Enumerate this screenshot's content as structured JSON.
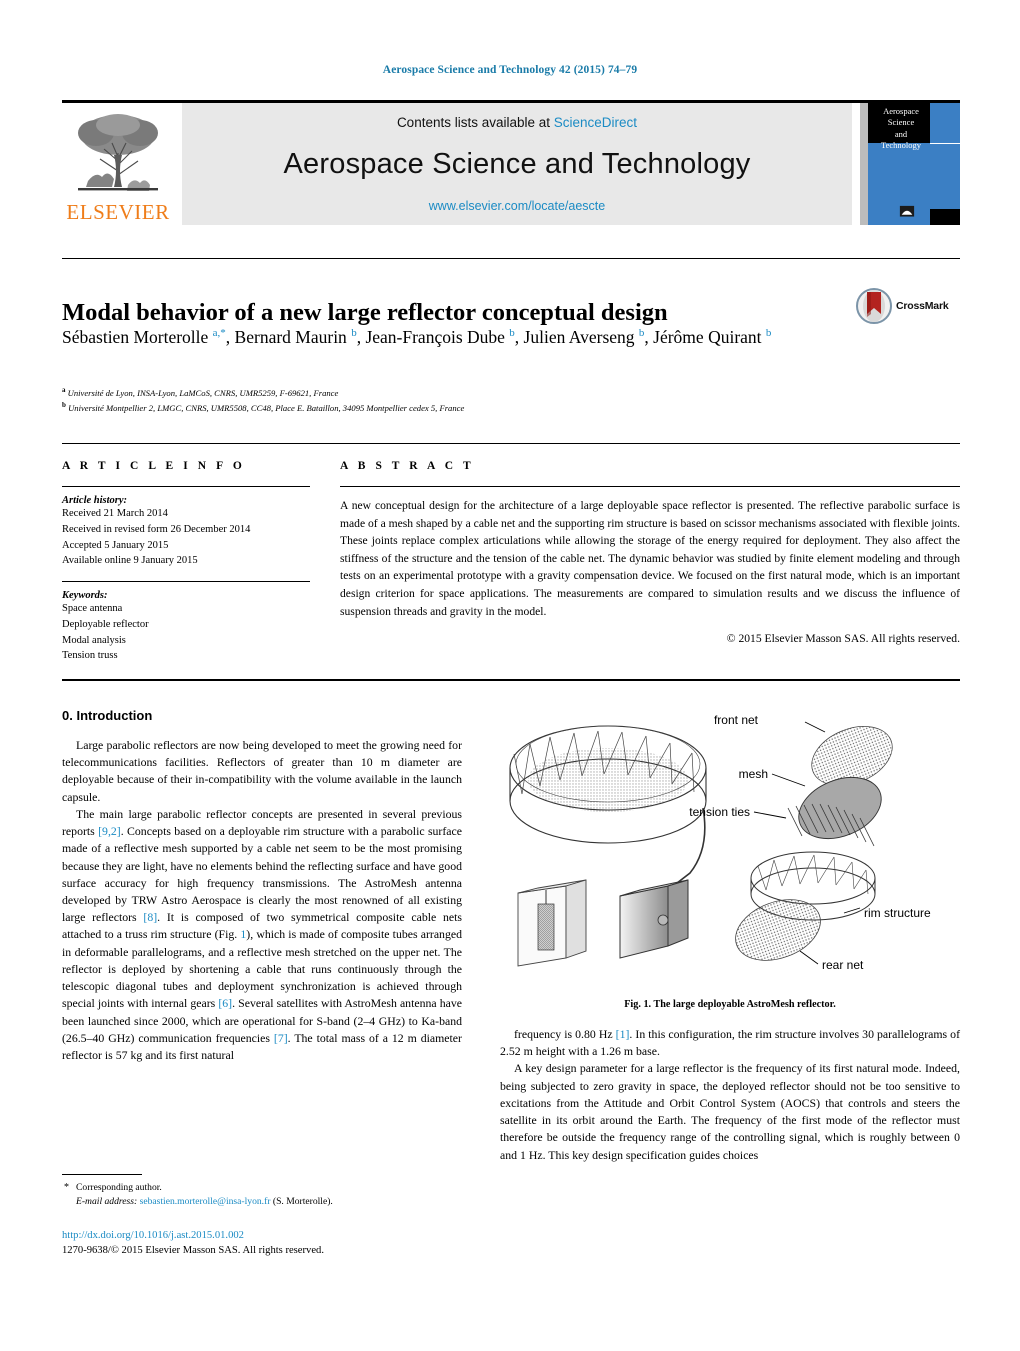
{
  "running_head": "Aerospace Science and Technology 42 (2015) 74–79",
  "masthead": {
    "publisher_name": "ELSEVIER",
    "contents_prefix": "Contents lists available at ",
    "contents_link": "ScienceDirect",
    "journal_name": "Aerospace Science and Technology",
    "journal_url": "www.elsevier.com/locate/aescte",
    "cover_title_line1": "Aerospace",
    "cover_title_line2": "Science",
    "cover_title_line3": "and",
    "cover_title_line4": "Technology",
    "link_color": "#1b8bc4",
    "banner_bg": "#e8e8e8",
    "brand_orange": "#ef7d1a",
    "cover_blue": "#3b7fc4"
  },
  "crossmark": {
    "label": "CrossMark"
  },
  "article": {
    "title": "Modal behavior of a new large reflector conceptual design",
    "authors_html": "Sébastien Morterolle <sup>a,*</sup>, Bernard Maurin <sup>b</sup>, Jean-François Dube <sup>b</sup>, Julien Averseng <sup>b</sup>, Jérôme Quirant <sup>b</sup>",
    "affiliation_a": "Université de Lyon, INSA-Lyon, LaMCoS, CNRS, UMR5259, F-69621, France",
    "affiliation_b": "Université Montpellier 2, LMGC, CNRS, UMR5508, CC48, Place E. Bataillon, 34095 Montpellier cedex 5, France",
    "affiliation_a_marker": "a",
    "affiliation_b_marker": "b"
  },
  "article_info": {
    "heading": "A R T I C L E  I N F O",
    "history_label": "Article history:",
    "history": [
      "Received 21 March 2014",
      "Received in revised form 26 December 2014",
      "Accepted 5 January 2015",
      "Available online 9 January 2015"
    ],
    "keywords_label": "Keywords:",
    "keywords": [
      "Space antenna",
      "Deployable reflector",
      "Modal analysis",
      "Tension truss"
    ]
  },
  "abstract": {
    "heading": "A B S T R A C T",
    "body": "A new conceptual design for the architecture of a large deployable space reflector is presented. The reflective parabolic surface is made of a mesh shaped by a cable net and the supporting rim structure is based on scissor mechanisms associated with flexible joints. These joints replace complex articulations while allowing the storage of the energy required for deployment. They also affect the stiffness of the structure and the tension of the cable net. The dynamic behavior was studied by finite element modeling and through tests on an experimental prototype with a gravity compensation device. We focused on the first natural mode, which is an important design criterion for space applications. The measurements are compared to simulation results and we discuss the influence of suspension threads and gravity in the model.",
    "copyright": "© 2015 Elsevier Masson SAS. All rights reserved."
  },
  "body": {
    "section_heading": "0. Introduction",
    "left_paragraphs": [
      "Large parabolic reflectors are now being developed to meet the growing need for telecommunications facilities. Reflectors of greater than 10 m diameter are deployable because of their in-compatibility with the volume available in the launch capsule.",
      "The main large parabolic reflector concepts are presented in several previous reports [9,2]. Concepts based on a deployable rim structure with a parabolic surface made of a reflective mesh supported by a cable net seem to be the most promising because they are light, have no elements behind the reflecting surface and have good surface accuracy for high frequency transmissions. The AstroMesh antenna developed by TRW Astro Aerospace is clearly the most renowned of all existing large reflectors [8]. It is composed of two symmetrical composite cable nets attached to a truss rim structure (Fig. 1), which is made of composite tubes arranged in deformable parallelograms, and a reflective mesh stretched on the upper net. The reflector is deployed by shortening a cable that runs continuously through the telescopic diagonal tubes and deployment synchronization is achieved through special joints with internal gears [6]. Several satellites with AstroMesh antenna have been launched since 2000, which are operational for S-band (2–4 GHz) to Ka-band (26.5–40 GHz) communication frequencies [7]. The total mass of a 12 m diameter reflector is 57 kg and its first natural"
    ],
    "right_paragraphs": [
      "frequency is 0.80 Hz [1]. In this configuration, the rim structure involves 30 parallelograms of 2.52 m height with a 1.26 m base.",
      "A key design parameter for a large reflector is the frequency of its first natural mode. Indeed, being subjected to zero gravity in space, the deployed reflector should not be too sensitive to excitations from the Attitude and Orbit Control System (AOCS) that controls and steers the satellite in its orbit around the Earth. The frequency of the first mode of the reflector must therefore be outside the frequency range of the controlling signal, which is roughly between 0 and 1 Hz. This key design specification guides choices"
    ]
  },
  "figure": {
    "caption_number": "Fig. 1.",
    "caption_text": "The large deployable AstroMesh reflector.",
    "labels": {
      "front_net": "front net",
      "mesh": "mesh",
      "tension_ties": "tension ties",
      "rim_structure": "rim structure",
      "rear_net": "rear net"
    }
  },
  "footnote": {
    "star": "*",
    "corresponding": "Corresponding author.",
    "email_label": "E-mail address:",
    "email": "sebastien.morterolle@insa-lyon.fr",
    "email_owner": "(S. Morterolle).",
    "doi": "http://dx.doi.org/10.1016/j.ast.2015.01.002",
    "issn_copyright": "1270-9638/© 2015 Elsevier Masson SAS. All rights reserved."
  }
}
